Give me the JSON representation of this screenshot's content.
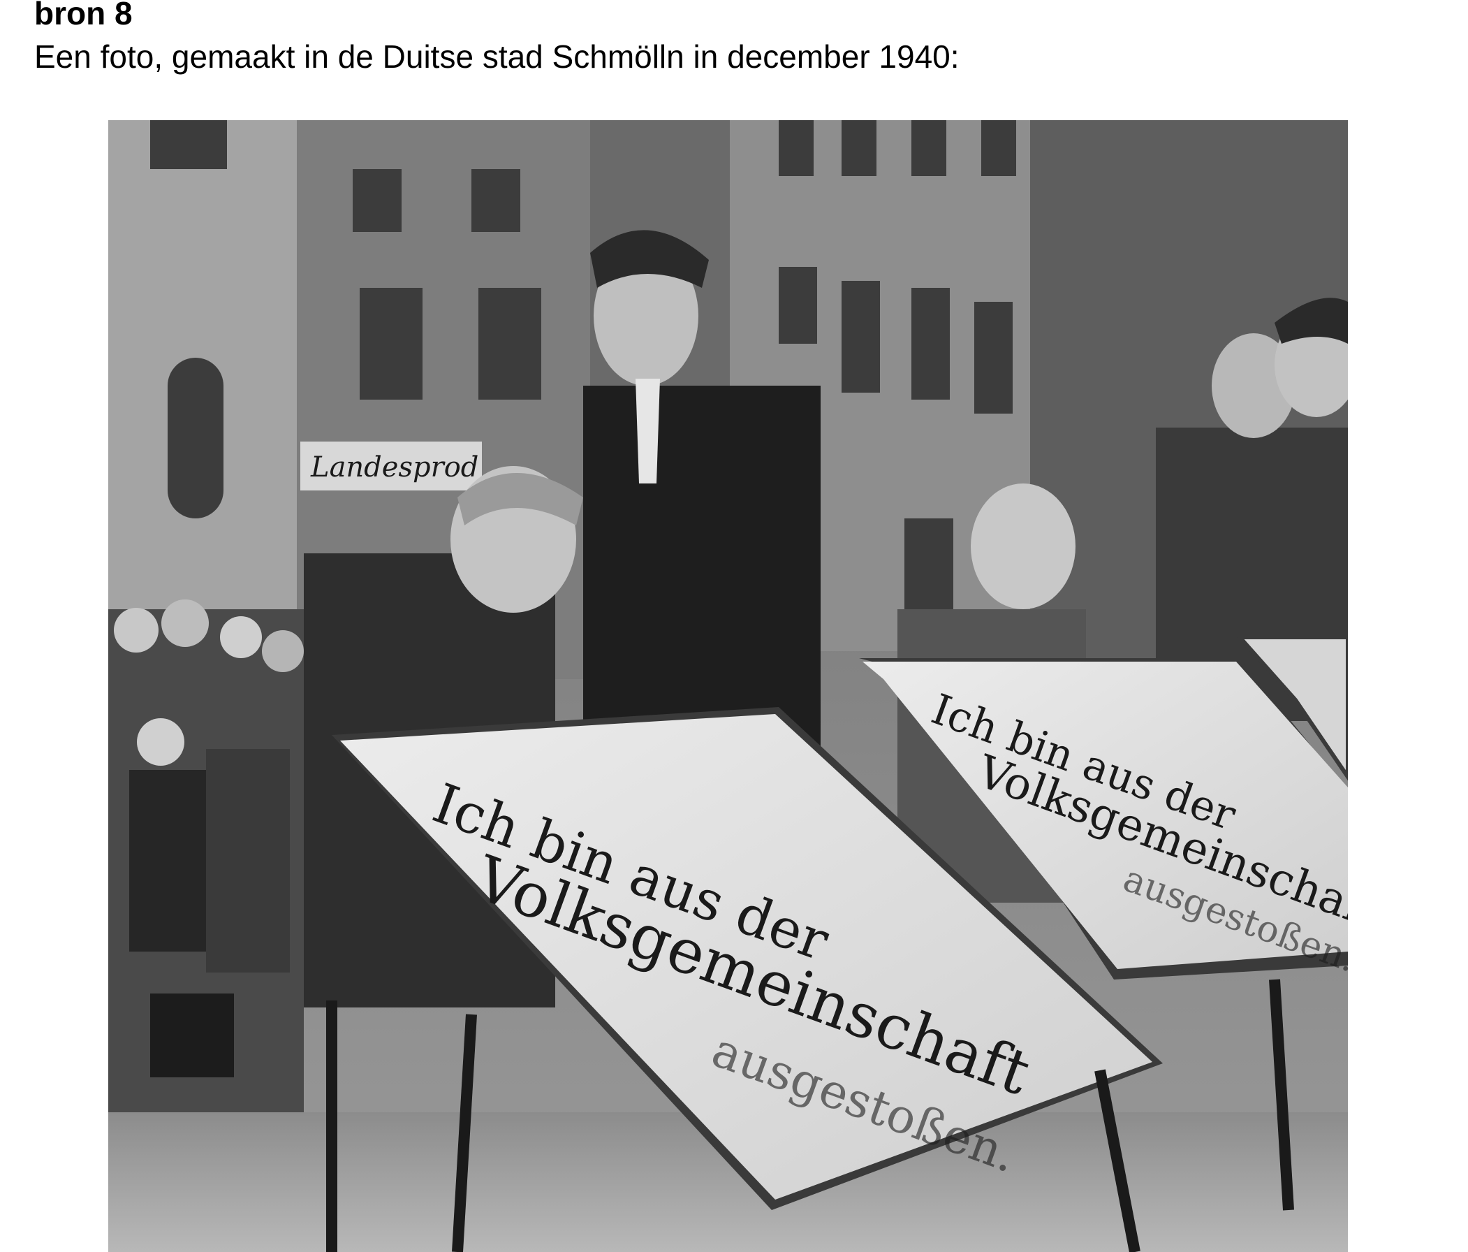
{
  "source": {
    "label": "bron 8",
    "caption": "Een foto, gemaakt in de Duitse stad Schmölln in december 1940:"
  },
  "photo": {
    "shop_sign_text": "Landesprod",
    "sign_main": {
      "line1": "Ich bin aus der",
      "line2": "Volksgemeinschaft",
      "line3": "ausgestoßen."
    },
    "sign_second": {
      "line1": "Ich bin aus der",
      "line2": "Volksgemeinschaft",
      "line3": "ausgestoßen."
    }
  }
}
